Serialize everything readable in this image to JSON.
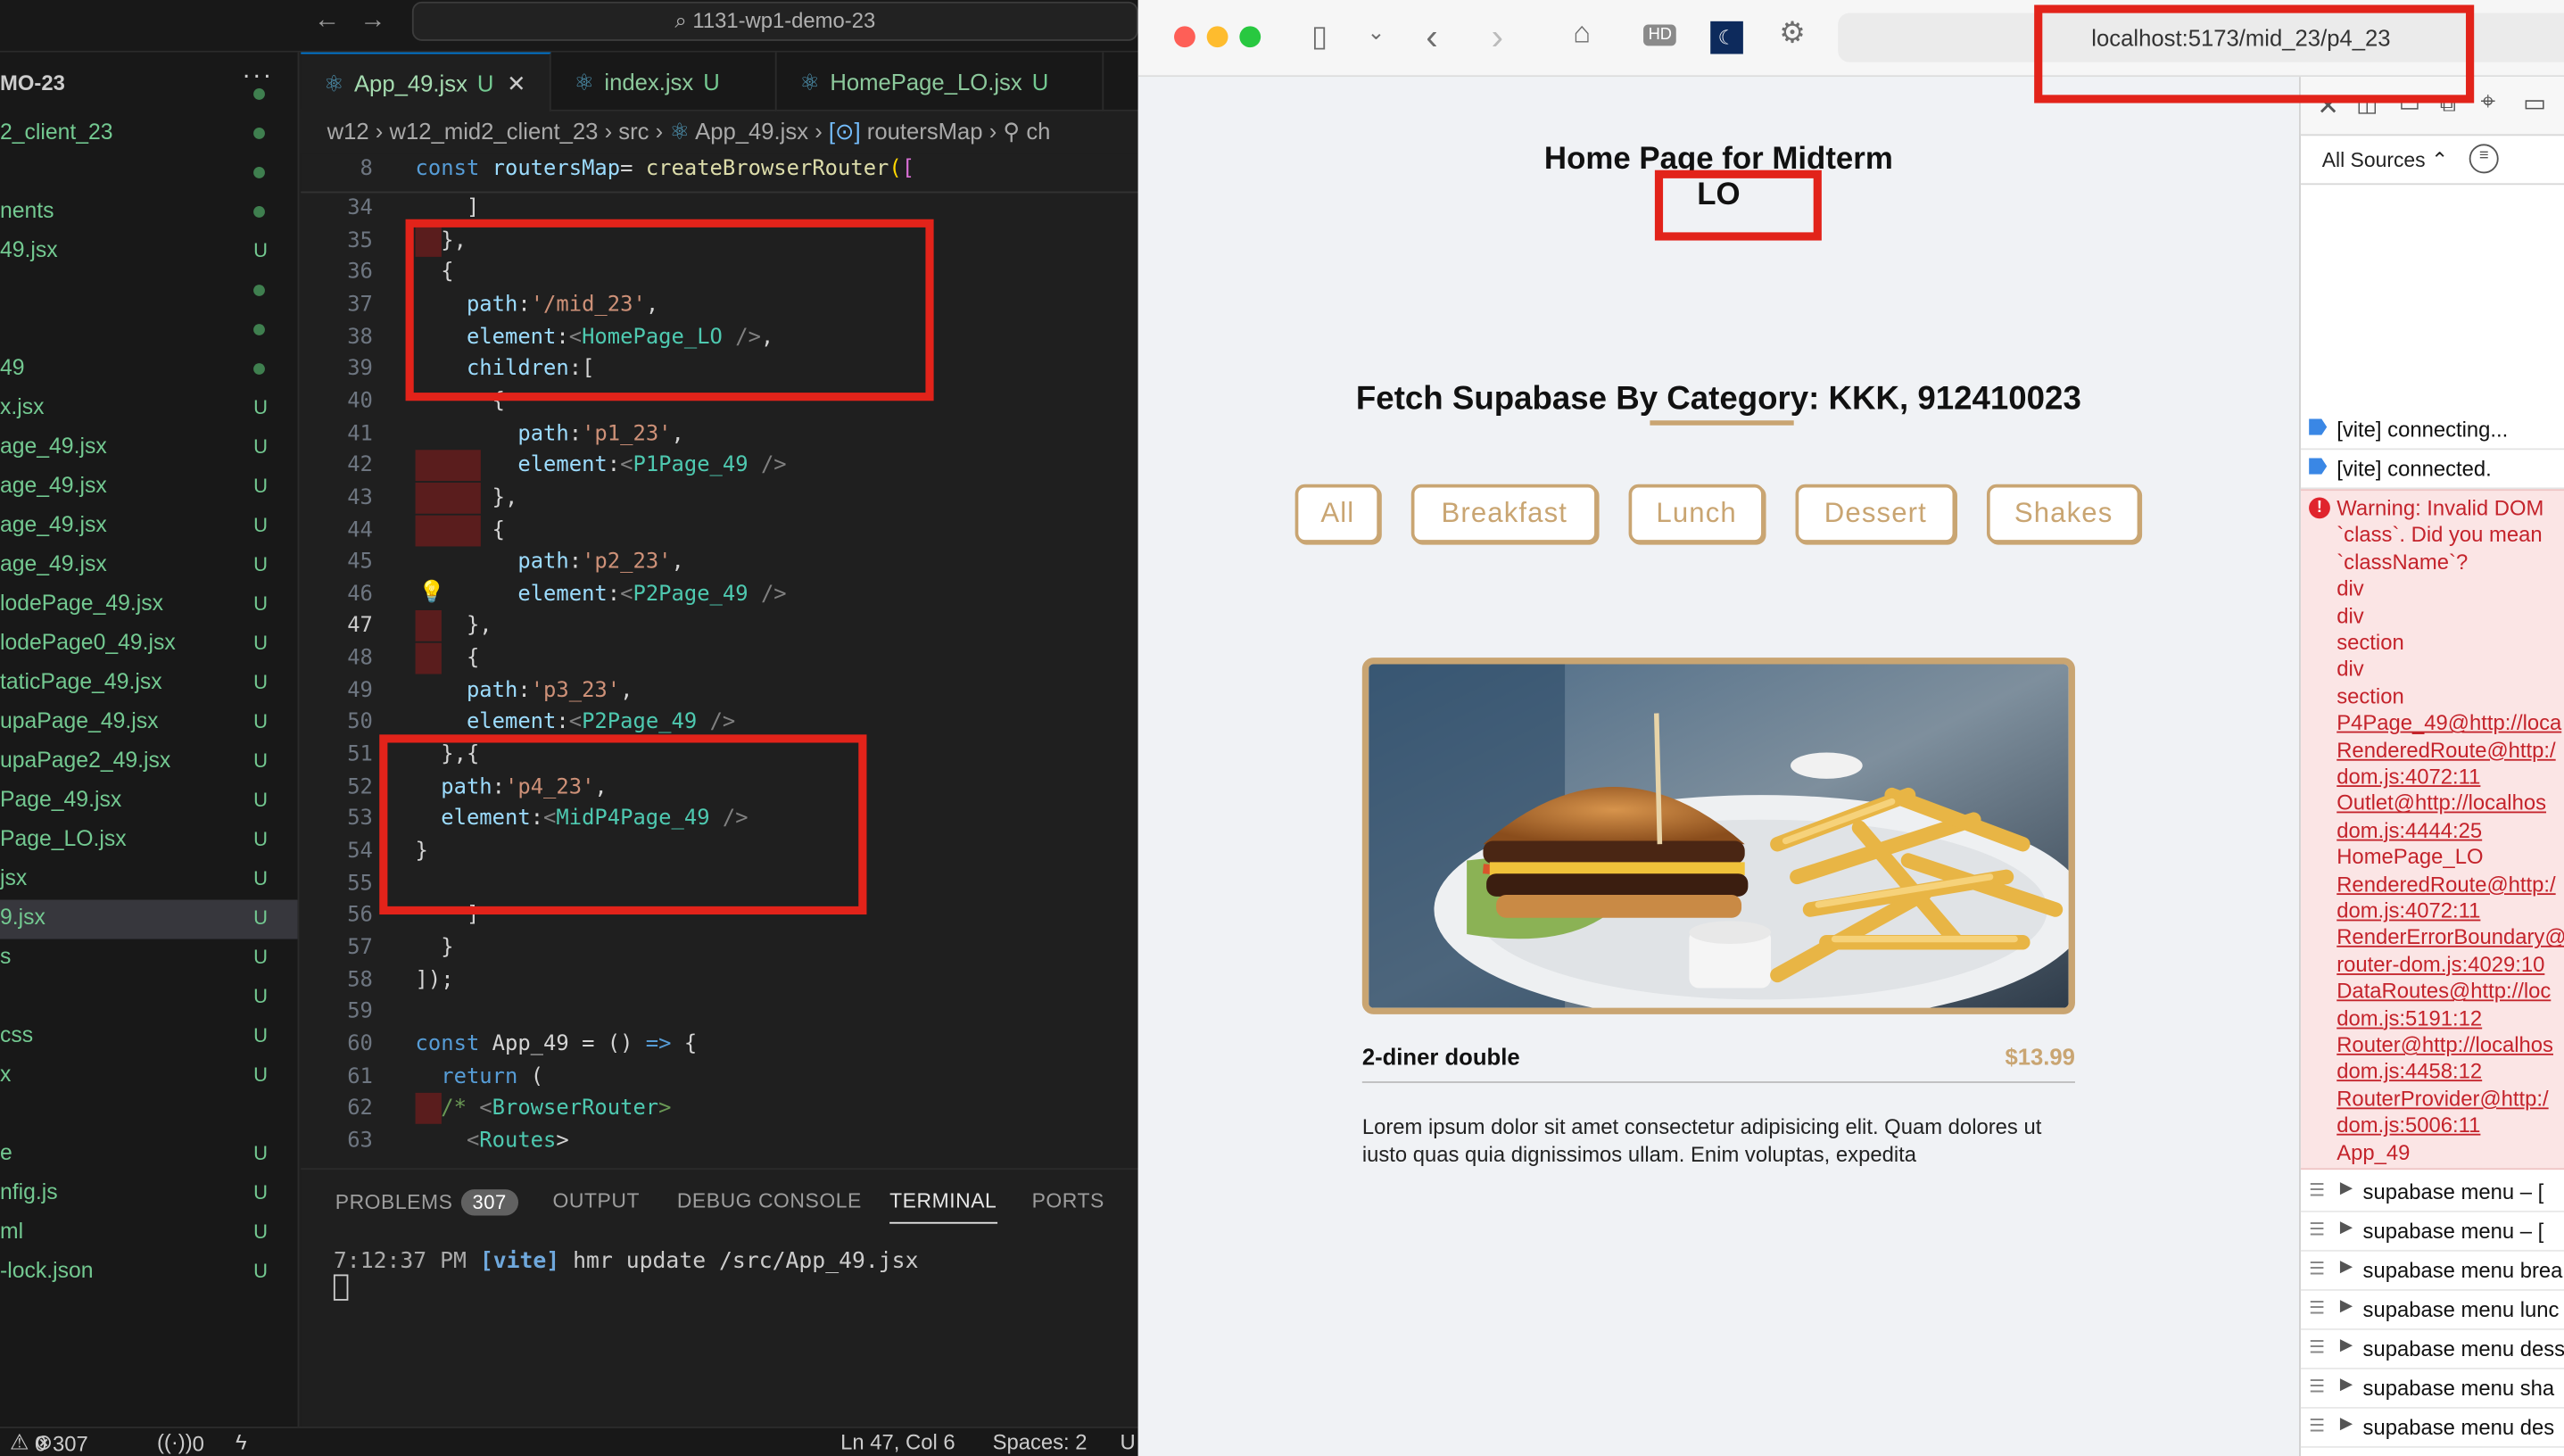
{
  "vscode": {
    "title_search": "1131-wp1-demo-23",
    "sidebar": {
      "heading": "MO-23",
      "items": [
        {
          "name": "",
          "status": "dot"
        },
        {
          "name": "2_client_23",
          "status": "dot"
        },
        {
          "name": "",
          "status": "dot"
        },
        {
          "name": "nents",
          "status": "dot"
        },
        {
          "name": "49.jsx",
          "status": "U"
        },
        {
          "name": "",
          "status": "dot"
        },
        {
          "name": "",
          "status": "dot"
        },
        {
          "name": "49",
          "status": "dot"
        },
        {
          "name": "x.jsx",
          "status": "U"
        },
        {
          "name": "age_49.jsx",
          "status": "U"
        },
        {
          "name": "age_49.jsx",
          "status": "U"
        },
        {
          "name": "age_49.jsx",
          "status": "U"
        },
        {
          "name": "age_49.jsx",
          "status": "U"
        },
        {
          "name": "lodePage_49.jsx",
          "status": "U"
        },
        {
          "name": "lodePage0_49.jsx",
          "status": "U"
        },
        {
          "name": "taticPage_49.jsx",
          "status": "U"
        },
        {
          "name": "upaPage_49.jsx",
          "status": "U"
        },
        {
          "name": "upaPage2_49.jsx",
          "status": "U"
        },
        {
          "name": "Page_49.jsx",
          "status": "U"
        },
        {
          "name": "Page_LO.jsx",
          "status": "U"
        },
        {
          "name": "jsx",
          "status": "U"
        },
        {
          "name": "9.jsx",
          "status": "U"
        },
        {
          "name": "s",
          "status": "U"
        },
        {
          "name": "",
          "status": "U"
        },
        {
          "name": "css",
          "status": "U"
        },
        {
          "name": "x",
          "status": "U"
        },
        {
          "name": "",
          "status": ""
        },
        {
          "name": "e",
          "status": "U"
        },
        {
          "name": "nfig.js",
          "status": "U"
        },
        {
          "name": "ml",
          "status": "U"
        },
        {
          "name": "-lock.json",
          "status": "U"
        }
      ]
    },
    "tabs": [
      {
        "label": "App_49.jsx",
        "flag": "U",
        "close": "✕"
      },
      {
        "label": "index.jsx",
        "flag": "U"
      },
      {
        "label": "HomePage_LO.jsx",
        "flag": "U"
      }
    ],
    "breadcrumb": [
      "w12",
      "w12_mid2_client_23",
      "src",
      "App_49.jsx",
      "routersMap",
      "ch"
    ],
    "sticky": {
      "num": "8",
      "text": "const routersMap= createBrowserRouter(["
    },
    "lines": [
      {
        "n": "34",
        "t": "    ]"
      },
      {
        "n": "35",
        "t": "  },"
      },
      {
        "n": "36",
        "t": "  {"
      },
      {
        "n": "37",
        "t": "    path:'/mid_23',"
      },
      {
        "n": "38",
        "t": "    element:<HomePage_LO />,"
      },
      {
        "n": "39",
        "t": "    children:["
      },
      {
        "n": "40",
        "t": "      {"
      },
      {
        "n": "41",
        "t": "        path:'p1_23',"
      },
      {
        "n": "42",
        "t": "        element:<P1Page_49 />"
      },
      {
        "n": "43",
        "t": "      },"
      },
      {
        "n": "44",
        "t": "      {"
      },
      {
        "n": "45",
        "t": "        path:'p2_23',"
      },
      {
        "n": "46",
        "t": "        element:<P2Page_49 />"
      },
      {
        "n": "47",
        "t": "    },"
      },
      {
        "n": "48",
        "t": "    {"
      },
      {
        "n": "49",
        "t": "    path:'p3_23',"
      },
      {
        "n": "50",
        "t": "    element:<P2Page_49 />"
      },
      {
        "n": "51",
        "t": "  },{"
      },
      {
        "n": "52",
        "t": "  path:'p4_23',"
      },
      {
        "n": "53",
        "t": "  element:<MidP4Page_49 />"
      },
      {
        "n": "54",
        "t": "}"
      },
      {
        "n": "55",
        "t": ""
      },
      {
        "n": "56",
        "t": "    ]"
      },
      {
        "n": "57",
        "t": "  }"
      },
      {
        "n": "58",
        "t": "]);"
      },
      {
        "n": "59",
        "t": ""
      },
      {
        "n": "60",
        "t": "const App_49 = () => {"
      },
      {
        "n": "61",
        "t": "  return ("
      },
      {
        "n": "62",
        "t": "  /* <BrowserRouter>"
      },
      {
        "n": "63",
        "t": "    <Routes>"
      }
    ],
    "panel": {
      "tabs": [
        "PROBLEMS",
        "OUTPUT",
        "DEBUG CONSOLE",
        "TERMINAL",
        "PORTS"
      ],
      "problems_count": "307",
      "terminal_time": "7:12:37 PM",
      "terminal_tag": "[vite]",
      "terminal_msg": "hmr update /src/App_49.jsx"
    },
    "status": {
      "errors": "0",
      "warnings": "307",
      "ports": "0",
      "cursor": "Ln 47, Col 6",
      "spaces": "Spaces: 2",
      "encoding": "U"
    }
  },
  "safari": {
    "hd_label": "HD",
    "url": "localhost:5173/mid_23/p4_23",
    "page": {
      "title_line1": "Home Page for Midterm",
      "title_line2": "LO",
      "section_title": "Fetch Supabase By Category: KKK, 912410023",
      "categories": [
        "All",
        "Breakfast",
        "Lunch",
        "Dessert",
        "Shakes"
      ],
      "item": {
        "title": "2-diner double",
        "price": "$13.99",
        "description": "Lorem ipsum dolor sit amet consectetur adipisicing elit. Quam dolores ut iusto quas quia dignissimos ullam. Enim voluptas, expedita"
      }
    },
    "devtools": {
      "source_filter": "All Sources",
      "info_logs": [
        "[vite] connecting...",
        "[vite] connected."
      ],
      "warning_lines": [
        {
          "t": "Warning: Invalid DOM",
          "u": false
        },
        {
          "t": "`class`. Did you mean",
          "u": false
        },
        {
          "t": "`className`?",
          "u": false
        },
        {
          "t": "div",
          "u": false
        },
        {
          "t": "div",
          "u": false
        },
        {
          "t": "section",
          "u": false
        },
        {
          "t": "div",
          "u": false
        },
        {
          "t": "section",
          "u": false
        },
        {
          "t": "P4Page_49@http://loca",
          "u": true
        },
        {
          "t": "RenderedRoute@http:/",
          "u": true
        },
        {
          "t": "dom.js:4072:11",
          "u": true
        },
        {
          "t": "Outlet@http://localhos",
          "u": true
        },
        {
          "t": "dom.js:4444:25",
          "u": true
        },
        {
          "t": "HomePage_LO",
          "u": false
        },
        {
          "t": "RenderedRoute@http:/",
          "u": true
        },
        {
          "t": "dom.js:4072:11",
          "u": true
        },
        {
          "t": "RenderErrorBoundary@",
          "u": true
        },
        {
          "t": "router-dom.js:4029:10",
          "u": true
        },
        {
          "t": "DataRoutes@http://loc",
          "u": true
        },
        {
          "t": "dom.js:5191:12",
          "u": true
        },
        {
          "t": "Router@http://localhos",
          "u": true
        },
        {
          "t": "dom.js:4458:12",
          "u": true
        },
        {
          "t": "RouterProvider@http:/",
          "u": true
        },
        {
          "t": "dom.js:5006:11",
          "u": true
        },
        {
          "t": "App_49",
          "u": false
        }
      ],
      "groups": [
        "supabase menu  – [",
        "supabase menu  – [",
        "supabase menu brea",
        "supabase menu lunc",
        "supabase menu dess",
        "supabase menu sha",
        "supabase menu des"
      ]
    }
  },
  "colors": {
    "annotation": "#e2231a",
    "accent_gold": "#c9a572"
  }
}
